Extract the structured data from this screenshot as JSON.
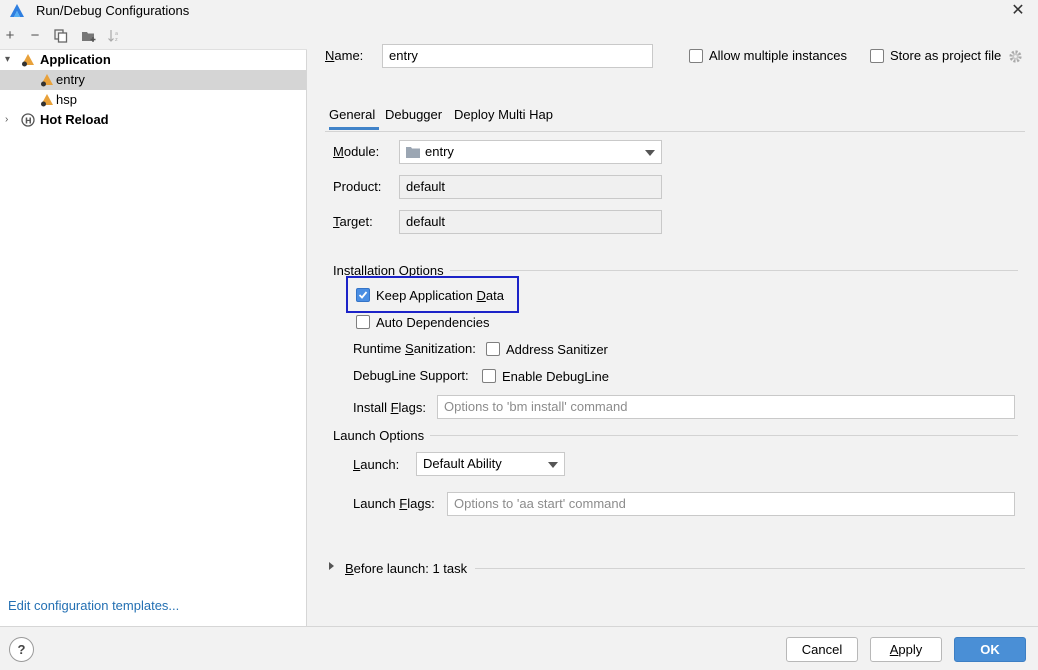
{
  "window": {
    "title": "Run/Debug Configurations"
  },
  "toolbar": {
    "icons": [
      "plus-icon",
      "minus-icon",
      "copy-icon",
      "folder-add-icon",
      "sort-icon"
    ]
  },
  "tree": {
    "items": [
      {
        "label": "Application",
        "icon": "application-icon"
      },
      {
        "label": "entry",
        "icon": "module-icon",
        "selected": true
      },
      {
        "label": "hsp",
        "icon": "module-icon"
      },
      {
        "label": "Hot Reload",
        "icon": "hot-reload-icon"
      }
    ]
  },
  "left_footer": {
    "edit_templates_link": "Edit configuration templates..."
  },
  "header": {
    "name_label": "Name:",
    "name_value": "entry",
    "allow_multiple_label": "Allow multiple instances",
    "allow_multiple_checked": false,
    "store_project_label": "Store as project file",
    "store_project_checked": false
  },
  "tabs": [
    {
      "label": "General",
      "active": true
    },
    {
      "label": "Debugger",
      "active": false
    },
    {
      "label": "Deploy Multi Hap",
      "active": false
    }
  ],
  "general": {
    "module_label": "Module:",
    "module_value": "entry",
    "product_label": "Product:",
    "product_value": "default",
    "target_label": "Target:",
    "target_value": "default",
    "installation_section": "Installation Options",
    "keep_app_data_label": "Keep Application Data",
    "keep_app_data_checked": true,
    "auto_deps_label": "Auto Dependencies",
    "auto_deps_checked": false,
    "runtime_sanitization_label": "Runtime Sanitization:",
    "address_sanitizer_label": "Address Sanitizer",
    "address_sanitizer_checked": false,
    "debugline_support_label": "DebugLine Support:",
    "enable_debugline_label": "Enable DebugLine",
    "enable_debugline_checked": false,
    "install_flags_label": "Install Flags:",
    "install_flags_placeholder": "Options to 'bm install' command",
    "launch_section": "Launch Options",
    "launch_label": "Launch:",
    "launch_value": "Default Ability",
    "launch_flags_label": "Launch Flags:",
    "launch_flags_placeholder": "Options to 'aa start' command",
    "before_launch_label": "Before launch: 1 task"
  },
  "footer": {
    "help_label": "?",
    "cancel_label": "Cancel",
    "apply_label": "Apply",
    "ok_label": "OK"
  },
  "colors": {
    "accent": "#4a8fd6",
    "highlight_box": "#1c23c8",
    "link": "#2470b3",
    "selected_row": "#d5d5d5"
  }
}
